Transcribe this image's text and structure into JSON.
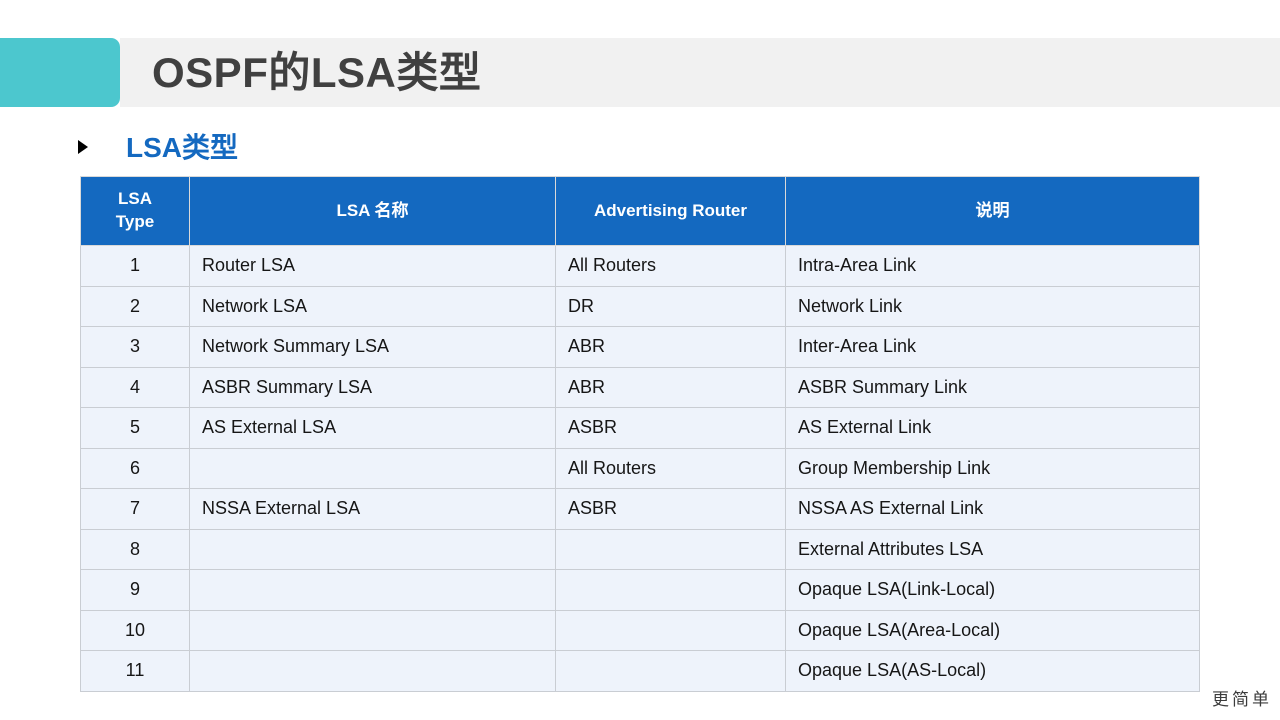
{
  "slide": {
    "title": "OSPF的LSA类型",
    "accent_color": "#4cc7ce",
    "header_bg": "#f1f1f1",
    "title_color": "#404040"
  },
  "subtitle": {
    "bullet_icon": "triangle-right-icon",
    "text": "LSA类型",
    "color": "#1469c0"
  },
  "table": {
    "header_bg": "#1469c0",
    "header_text_color": "#ffffff",
    "row_bg": "#eef3fb",
    "grid_color": "#c9cdd3",
    "columns": [
      {
        "key": "type",
        "label": "LSA\nType",
        "label_line1": "LSA",
        "label_line2": "Type"
      },
      {
        "key": "name",
        "label": "LSA 名称"
      },
      {
        "key": "adv",
        "label": "Advertising Router"
      },
      {
        "key": "desc",
        "label": "说明"
      }
    ],
    "rows": [
      {
        "type": "1",
        "name": "Router LSA",
        "adv": "All Routers",
        "desc": "Intra-Area Link"
      },
      {
        "type": "2",
        "name": "Network LSA",
        "adv": "DR",
        "desc": "Network Link"
      },
      {
        "type": "3",
        "name": "Network Summary LSA",
        "adv": "ABR",
        "desc": "Inter-Area  Link"
      },
      {
        "type": "4",
        "name": "ASBR Summary LSA",
        "adv": "ABR",
        "desc": "ASBR Summary  Link"
      },
      {
        "type": "5",
        "name": "AS External LSA",
        "adv": "ASBR",
        "desc": "AS External Link"
      },
      {
        "type": "6",
        "name": "",
        "adv": "All Routers",
        "desc": "Group Membership  Link"
      },
      {
        "type": "7",
        "name": "NSSA External LSA",
        "adv": "ASBR",
        "desc": "NSSA AS External Link"
      },
      {
        "type": "8",
        "name": "",
        "adv": "",
        "desc": "External Attributes LSA"
      },
      {
        "type": "9",
        "name": "",
        "adv": "",
        "desc": "Opaque LSA(Link-Local)"
      },
      {
        "type": "10",
        "name": "",
        "adv": "",
        "desc": "Opaque LSA(Area-Local)"
      },
      {
        "type": "11",
        "name": "",
        "adv": "",
        "desc": "Opaque LSA(AS-Local)"
      }
    ]
  },
  "watermark": {
    "text": "更简单",
    "faint_text": ""
  }
}
